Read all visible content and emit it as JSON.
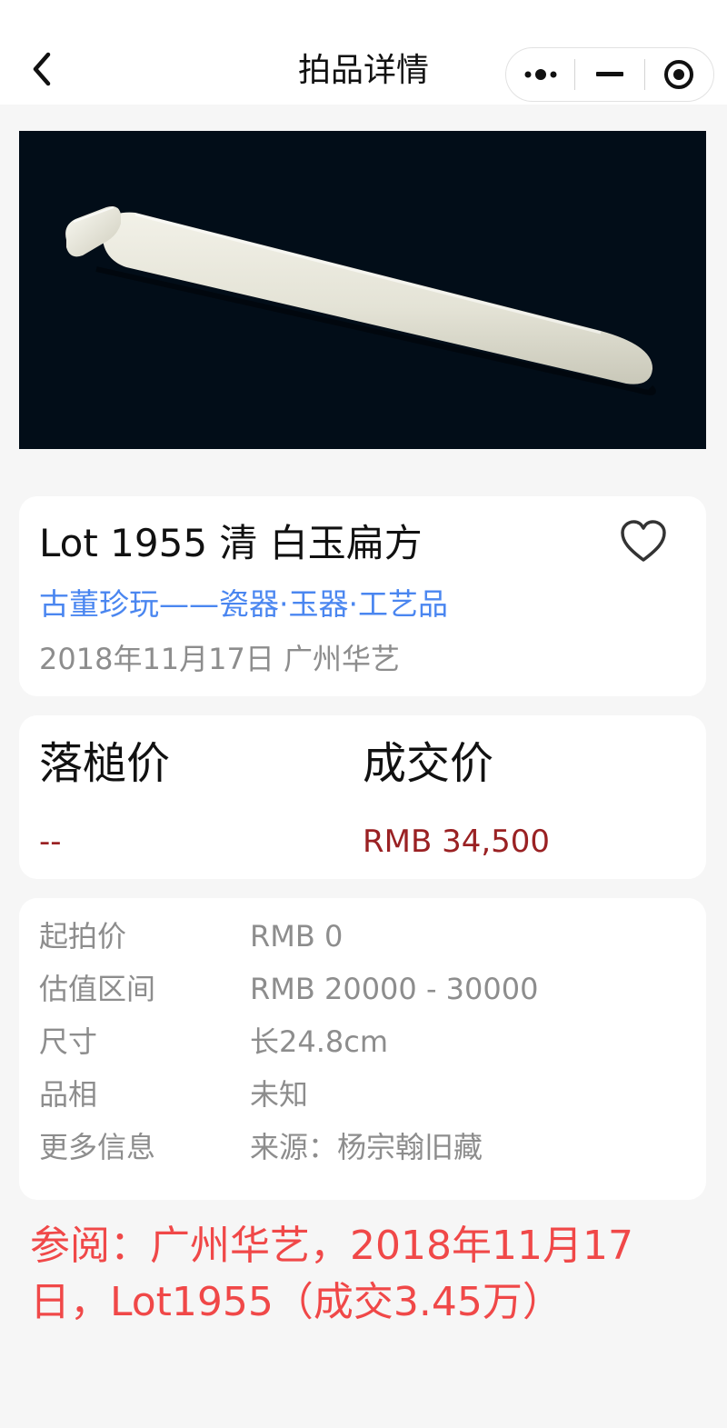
{
  "header": {
    "title": "拍品详情",
    "back_icon": "chevron-left-icon",
    "capsule": [
      "more-dots-icon",
      "minimize-icon",
      "close-circle-icon"
    ]
  },
  "hero": {
    "image_subject": "white-jade-flat-ruler"
  },
  "lot": {
    "title": "Lot 1955 清 白玉扁方",
    "category": "古董珍玩——瓷器·玉器·工艺品",
    "date_house": "2018年11月17日 广州华艺",
    "favorite_icon": "heart-outline-icon"
  },
  "price": {
    "hammer_label": "落槌价",
    "hammer_value": "--",
    "deal_label": "成交价",
    "deal_value": "RMB 34,500",
    "value_color": "#9a2123"
  },
  "info": {
    "rows": [
      {
        "key": "起拍价",
        "value": "RMB 0"
      },
      {
        "key": "估值区间",
        "value": "RMB 20000 - 30000"
      },
      {
        "key": "尺寸",
        "value": "长24.8cm"
      },
      {
        "key": "品相",
        "value": "未知"
      },
      {
        "key": "更多信息",
        "value": "来源：杨宗翰旧藏"
      }
    ]
  },
  "note": "参阅：广州华艺，2018年11月17日，Lot1955（成交3.45万）",
  "colors": {
    "link": "#4a86f0",
    "note": "#f04848",
    "muted": "#8d8d8d",
    "page_bg": "#f6f6f6"
  }
}
